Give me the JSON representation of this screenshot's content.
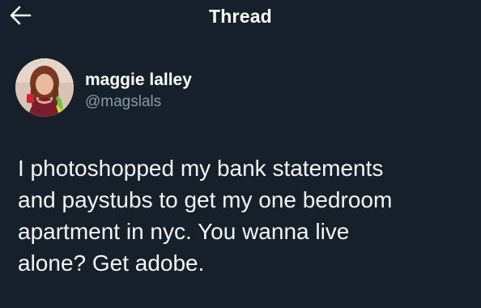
{
  "header": {
    "title": "Thread",
    "back_icon": "arrow-left-icon"
  },
  "tweet": {
    "author": {
      "display_name": "maggie lalley",
      "handle": "@magslals"
    },
    "text": "I photoshopped my bank statements\nand paystubs to get my one bedroom\napartment in nyc. You wanna live\nalone? Get adobe."
  },
  "colors": {
    "background": "#15202b",
    "text_primary": "#ffffff",
    "text_secondary": "#8b98a5"
  }
}
